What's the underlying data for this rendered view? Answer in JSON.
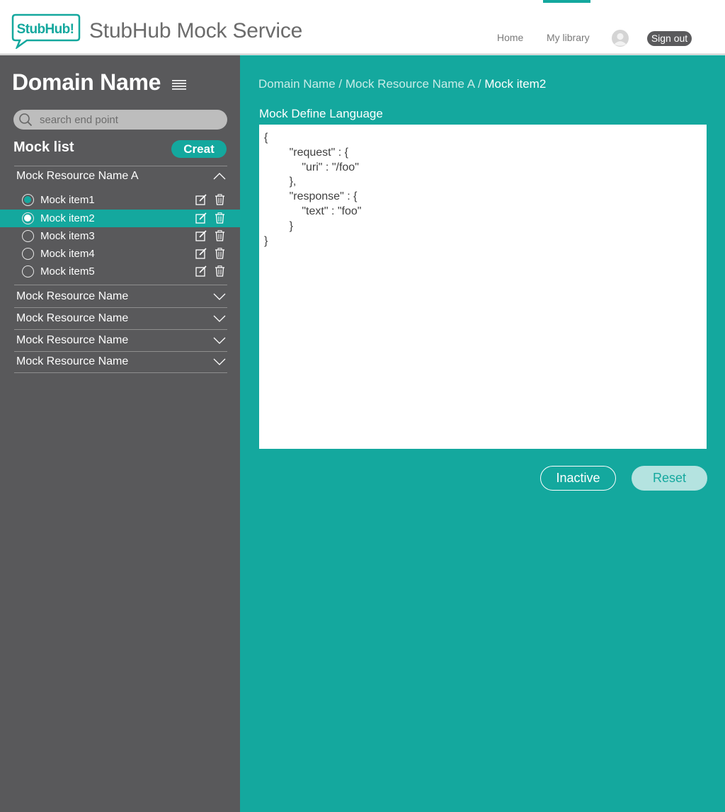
{
  "header": {
    "logo_text": "StubHub!",
    "app_title": "StubHub Mock Service",
    "nav": {
      "home": "Home",
      "library": "My library"
    },
    "signout_label": "Sign out",
    "accent_color": "#14a89e"
  },
  "sidebar": {
    "domain_title": "Domain Name",
    "search_placeholder": "search end point",
    "mock_list_title": "Mock list",
    "create_label": "Creat",
    "resources": [
      {
        "label": "Mock Resource Name A",
        "expanded": true,
        "items": [
          {
            "label": "Mock item1",
            "state": "radio-filled"
          },
          {
            "label": "Mock item2",
            "state": "selected"
          },
          {
            "label": "Mock item3",
            "state": "empty"
          },
          {
            "label": "Mock item4",
            "state": "empty"
          },
          {
            "label": "Mock item5",
            "state": "empty"
          }
        ]
      },
      {
        "label": "Mock Resource Name",
        "expanded": false
      },
      {
        "label": "Mock Resource Name",
        "expanded": false
      },
      {
        "label": "Mock Resource Name",
        "expanded": false
      },
      {
        "label": "Mock Resource Name",
        "expanded": false
      }
    ]
  },
  "main": {
    "breadcrumb": [
      {
        "label": "Domain Name"
      },
      {
        "label": "Mock Resource Name A"
      },
      {
        "label": "Mock item2"
      }
    ],
    "breadcrumb_sep": " / ",
    "section_label": "Mock Define Language",
    "code": "{\n        \"request\" : {\n            \"uri\" : \"/foo\"\n        },\n        \"response\" : {\n            \"text\" : \"foo\"\n        }\n}",
    "inactive_label": "Inactive",
    "reset_label": "Reset"
  }
}
